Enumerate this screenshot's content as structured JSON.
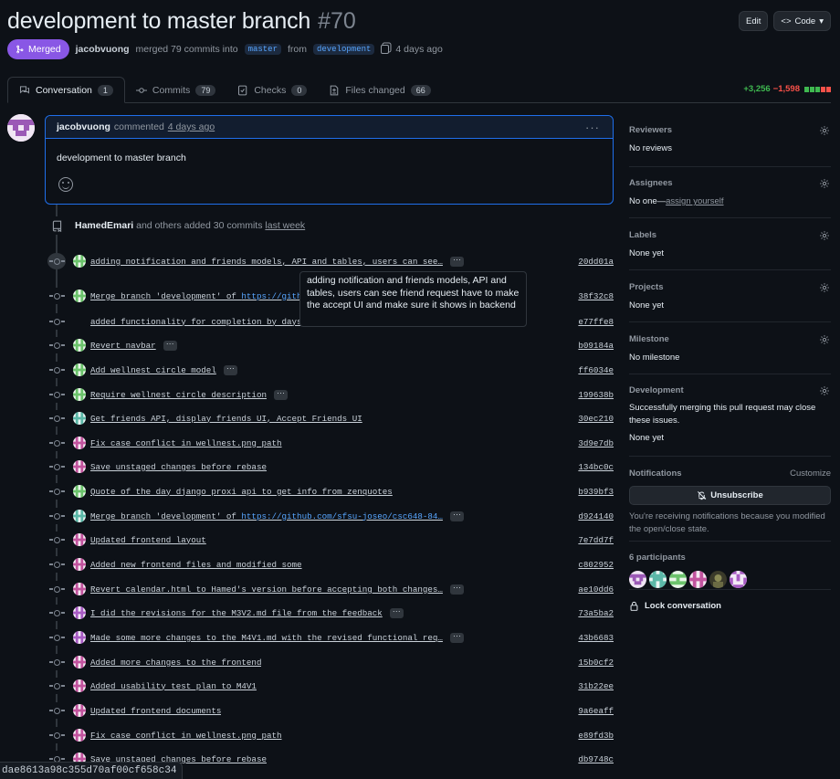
{
  "header": {
    "title": "development to master branch",
    "number": "#70",
    "edit_label": "Edit",
    "code_label": "Code"
  },
  "meta": {
    "status": "Merged",
    "author": "jacobvuong",
    "merged_text": "merged 79 commits into",
    "base_branch": "master",
    "from_text": "from",
    "head_branch": "development",
    "time": "4 days ago"
  },
  "tabs": [
    {
      "label": "Conversation",
      "count": "1",
      "icon": "conversation-icon"
    },
    {
      "label": "Commits",
      "count": "79",
      "icon": "commit-icon"
    },
    {
      "label": "Checks",
      "count": "0",
      "icon": "checklist-icon"
    },
    {
      "label": "Files changed",
      "count": "66",
      "icon": "file-diff-icon"
    }
  ],
  "diffstat": {
    "additions": "+3,256",
    "deletions": "−1,598"
  },
  "comment": {
    "author": "jacobvuong",
    "action": "commented",
    "time": "4 days ago",
    "body": "development to master branch"
  },
  "added_commits": {
    "author": "HamedEmari",
    "text": "and others added 30 commits",
    "time": "last week"
  },
  "tooltip": "adding notification and friends models,  API and tables, users can see friend request have to make the accept UI and make sure it shows in backend",
  "commits": [
    {
      "msg": "adding notification and friends models, API and tables, users can see…",
      "link": "",
      "sha": "20dd01a",
      "ellipsis": true,
      "avatar": "green"
    },
    {
      "msg": "Merge branch 'development' of ",
      "link": "https://github.com/sfsu-joseo/csc648-84…",
      "sha": "38f32c8",
      "ellipsis": false,
      "avatar": "green"
    },
    {
      "msg": "added functionality for completion by days",
      "link": "",
      "sha": "e77ffe8",
      "ellipsis": false,
      "avatar": "none"
    },
    {
      "msg": "Revert navbar",
      "link": "",
      "sha": "b09184a",
      "ellipsis": true,
      "avatar": "green"
    },
    {
      "msg": "Add wellnest circle model",
      "link": "",
      "sha": "ff6034e",
      "ellipsis": true,
      "avatar": "green"
    },
    {
      "msg": "Require wellnest circle description",
      "link": "",
      "sha": "199638b",
      "ellipsis": true,
      "avatar": "green"
    },
    {
      "msg": "Get friends API, display friends UI, Accept Friends UI",
      "link": "",
      "sha": "30ec210",
      "ellipsis": false,
      "avatar": "teal"
    },
    {
      "msg": "Fix case conflict in wellnest.png path",
      "link": "",
      "sha": "3d9e7db",
      "ellipsis": false,
      "avatar": "pink"
    },
    {
      "msg": "Save unstaged changes before rebase",
      "link": "",
      "sha": "134bc0c",
      "ellipsis": false,
      "avatar": "pink"
    },
    {
      "msg": "Quote of the day django proxi api to get info from zenquotes",
      "link": "",
      "sha": "b939bf3",
      "ellipsis": false,
      "avatar": "green"
    },
    {
      "msg": "Merge branch 'development' of ",
      "link": "https://github.com/sfsu-joseo/csc648-84…",
      "sha": "d924140",
      "ellipsis": true,
      "avatar": "teal"
    },
    {
      "msg": "Updated frontend layout",
      "link": "",
      "sha": "7e7dd7f",
      "ellipsis": false,
      "avatar": "pink"
    },
    {
      "msg": "Added new frontend files and modified some",
      "link": "",
      "sha": "c802952",
      "ellipsis": false,
      "avatar": "pink"
    },
    {
      "msg": "Revert calendar.html to Hamed's version before accepting both changes…",
      "link": "",
      "sha": "ae10dd6",
      "ellipsis": true,
      "avatar": "pink"
    },
    {
      "msg": "I did the revisions for the M3V2.md file from the feedback",
      "link": "",
      "sha": "73a5ba2",
      "ellipsis": true,
      "avatar": "purple"
    },
    {
      "msg": "Made some more changes to the M4V1.md with the revised functional req…",
      "link": "",
      "sha": "43b6683",
      "ellipsis": true,
      "avatar": "purple"
    },
    {
      "msg": "Added more changes to the frontend",
      "link": "",
      "sha": "15b0cf2",
      "ellipsis": false,
      "avatar": "pink"
    },
    {
      "msg": "Added usability test plan to M4V1",
      "link": "",
      "sha": "31b22ee",
      "ellipsis": false,
      "avatar": "pink"
    },
    {
      "msg": "Updated frontend documents",
      "link": "",
      "sha": "9a6eaff",
      "ellipsis": false,
      "avatar": "pink"
    },
    {
      "msg": "Fix case conflict in wellnest.png path",
      "link": "",
      "sha": "e89fd3b",
      "ellipsis": false,
      "avatar": "pink"
    },
    {
      "msg": "Save unstaged changes before rebase",
      "link": "",
      "sha": "db9748c",
      "ellipsis": false,
      "avatar": "pink"
    }
  ],
  "status_url": "dae8613a98c355d70af00cf658c34",
  "sidebar": {
    "reviewers": {
      "title": "Reviewers",
      "value": "No reviews"
    },
    "assignees": {
      "title": "Assignees",
      "value": "No one—",
      "link": "assign yourself"
    },
    "labels": {
      "title": "Labels",
      "value": "None yet"
    },
    "projects": {
      "title": "Projects",
      "value": "None yet"
    },
    "milestone": {
      "title": "Milestone",
      "value": "No milestone"
    },
    "development": {
      "title": "Development",
      "text": "Successfully merging this pull request may close these issues.",
      "value": "None yet"
    },
    "notifications": {
      "title": "Notifications",
      "customize": "Customize",
      "button": "Unsubscribe",
      "note": "You're receiving notifications because you modified the open/close state."
    },
    "participants": {
      "title": "6 participants"
    },
    "lock": "Lock conversation"
  },
  "colors": {
    "accent": "#58a6ff",
    "merged": "#8957e5",
    "add": "#3fb950",
    "del": "#f85149"
  }
}
